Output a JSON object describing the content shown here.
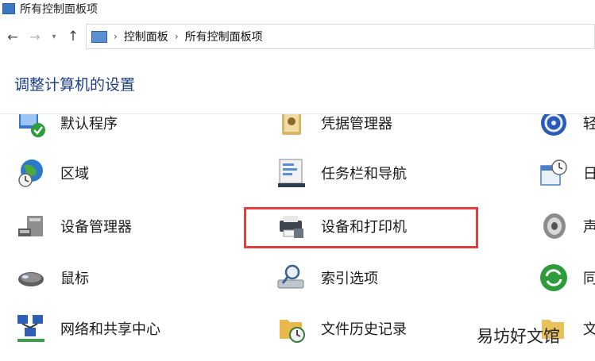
{
  "window": {
    "title": "所有控制面板项"
  },
  "address": {
    "crumbs": [
      "控制面板",
      "所有控制面板项"
    ]
  },
  "heading": "调整计算机的设置",
  "items": [
    {
      "label": "默认程序",
      "icon": "default-programs-icon"
    },
    {
      "label": "凭据管理器",
      "icon": "credential-manager-icon"
    },
    {
      "label": "轻",
      "icon": "ease-of-access-icon"
    },
    {
      "label": "区域",
      "icon": "region-globe-icon"
    },
    {
      "label": "任务栏和导航",
      "icon": "taskbar-icon"
    },
    {
      "label": "日",
      "icon": "date-time-icon"
    },
    {
      "label": "设备管理器",
      "icon": "device-manager-icon"
    },
    {
      "label": "设备和打印机",
      "icon": "printer-icon"
    },
    {
      "label": "声",
      "icon": "sound-icon"
    },
    {
      "label": "鼠标",
      "icon": "mouse-icon"
    },
    {
      "label": "索引选项",
      "icon": "indexing-icon"
    },
    {
      "label": "同",
      "icon": "sync-icon"
    },
    {
      "label": "网络和共享中心",
      "icon": "network-icon"
    },
    {
      "label": "文件历史记录",
      "icon": "file-history-icon"
    },
    {
      "label": "文",
      "icon": "folder-icon"
    }
  ],
  "watermark": "易坊好文馆"
}
